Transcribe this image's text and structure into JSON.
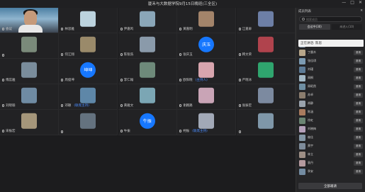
{
  "window": {
    "title": "厦禾与大数据学院9月15日晚班(三全区)",
    "controls": [
      "—",
      "□",
      "✕"
    ]
  },
  "grid": {
    "cells": [
      {
        "kind": "video",
        "name": "会议",
        "tag": ""
      },
      {
        "kind": "thumb",
        "name": "林思雅",
        "tag": "",
        "color": "#bcd3de"
      },
      {
        "kind": "thumb",
        "name": "尹嘉鸣",
        "tag": "",
        "color": "#8aa6b8"
      },
      {
        "kind": "thumb",
        "name": "黄嘉明",
        "tag": "",
        "color": "#a3846a"
      },
      {
        "kind": "thumb",
        "name": "江嘉扉",
        "tag": "",
        "color": "#6d7fa6"
      },
      {
        "kind": "thumb",
        "name": "",
        "tag": "",
        "color": "#7a8a7a"
      },
      {
        "kind": "thumb",
        "name": "何江翔",
        "tag": "",
        "color": "#9a8a6a"
      },
      {
        "kind": "thumb",
        "name": "陈锐浩",
        "tag": "",
        "color": "#8a9aaa"
      },
      {
        "kind": "avatar",
        "name": "张庆玉",
        "tag": "",
        "text": "庆玉"
      },
      {
        "kind": "thumb",
        "name": "韩文荣",
        "tag": "",
        "color": "#b0434d"
      },
      {
        "kind": "thumb",
        "name": "傅蕊雅",
        "tag": "",
        "color": "#7a8d9c"
      },
      {
        "kind": "avatar",
        "name": "周俊坤",
        "tag": "",
        "text": "坤坤"
      },
      {
        "kind": "thumb",
        "name": "李仁翰",
        "tag": "",
        "color": "#6e8a7a"
      },
      {
        "kind": "thumb",
        "name": "欧阳晓",
        "tag": "(主持人)",
        "color": "#d8a5ae"
      },
      {
        "kind": "thumb",
        "name": "严晓冰",
        "tag": "",
        "color": "#2fa56e"
      },
      {
        "kind": "thumb",
        "name": "刘晓瑜",
        "tag": "",
        "color": "#6f8ba3"
      },
      {
        "kind": "thumb",
        "name": "邓颖",
        "tag": "(联席主持)",
        "color": "#5e87a8"
      },
      {
        "kind": "thumb",
        "name": "黄雅文",
        "tag": "",
        "color": "#7ba6b4"
      },
      {
        "kind": "thumb",
        "name": "谢路路",
        "tag": "",
        "color": "#c9a4b6"
      },
      {
        "kind": "thumb",
        "name": "张振宏",
        "tag": "",
        "color": "#7c8aa0"
      },
      {
        "kind": "thumb",
        "name": "宋振宏",
        "tag": "",
        "color": "#a5967a"
      },
      {
        "kind": "thumb",
        "name": "",
        "tag": "",
        "color": "#64727f"
      },
      {
        "kind": "avatar",
        "name": "牛振",
        "tag": "",
        "text": "牛振"
      },
      {
        "kind": "thumb",
        "name": "柯振",
        "tag": "(联席主持)",
        "color": "#a2a9b7"
      },
      {
        "kind": "thumb",
        "name": "",
        "tag": "",
        "color": "#7f97a9"
      }
    ]
  },
  "panel": {
    "title": "成员列表",
    "search_placeholder": "搜索成员",
    "tabs": [
      "会议中(30)",
      "未进入(10)"
    ],
    "popup_text": "正在讲话: 陈思",
    "members": [
      {
        "name": "王君熙",
        "action": "",
        "color": "#8fa1b3"
      },
      {
        "name": "丁晨木",
        "action": "邀请",
        "color": "#b7a68a"
      },
      {
        "name": "张佳琪",
        "action": "邀请",
        "color": "#7c9bb2"
      },
      {
        "name": "刘瑾",
        "action": "邀请",
        "color": "#5d7b96"
      },
      {
        "name": "周桐",
        "action": "邀请",
        "color": "#a3b9c6"
      },
      {
        "name": "周昭然",
        "action": "邀请",
        "color": "#6f8fa3"
      },
      {
        "name": "苏卓",
        "action": "邀请",
        "color": "#8b7d6e"
      },
      {
        "name": "胡静",
        "action": "邀请",
        "color": "#9aa3ad"
      },
      {
        "name": "陈涵",
        "action": "邀请",
        "color": "#a97b5e"
      },
      {
        "name": "徐虹",
        "action": "邀请",
        "color": "#6a8472"
      },
      {
        "name": "刘晓梅",
        "action": "邀请",
        "color": "#b4a0b9"
      },
      {
        "name": "崔佳",
        "action": "邀请",
        "color": "#8497a6"
      },
      {
        "name": "黄宇",
        "action": "邀请",
        "color": "#7e8c9b"
      },
      {
        "name": "林立",
        "action": "邀请",
        "color": "#9e8f86"
      },
      {
        "name": "袁丹",
        "action": "邀请",
        "color": "#b59a9f"
      },
      {
        "name": "季安",
        "action": "邀请",
        "color": "#738ba1"
      }
    ],
    "invite_all": "全部邀请"
  }
}
